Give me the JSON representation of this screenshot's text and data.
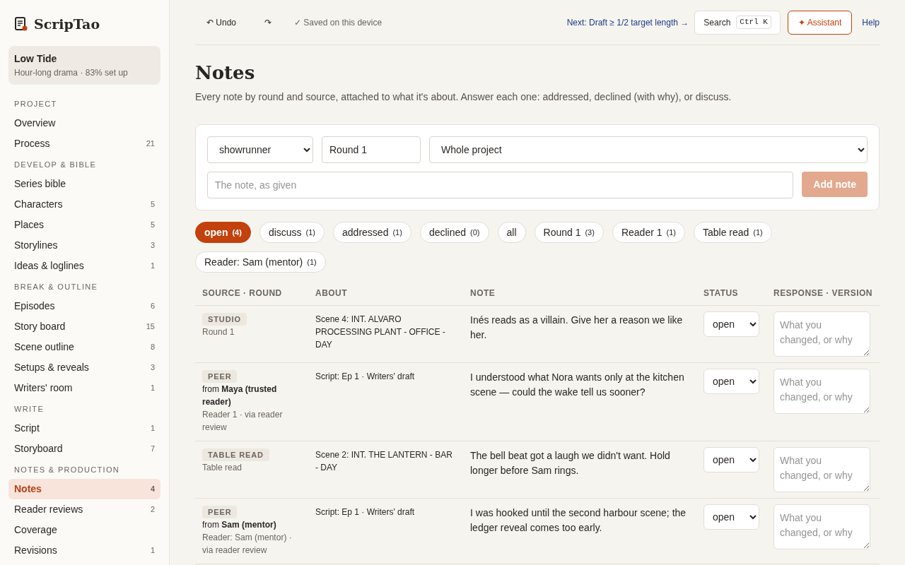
{
  "app": {
    "name": "ScripTao"
  },
  "project": {
    "title": "Low Tide",
    "subtitle": "Hour-long drama · 83% set up"
  },
  "nav": [
    {
      "heading": "PROJECT",
      "items": [
        {
          "label": "Overview",
          "selected": false
        },
        {
          "label": "Process",
          "count": "21",
          "selected": false
        }
      ]
    },
    {
      "heading": "DEVELOP & BIBLE",
      "items": [
        {
          "label": "Series bible",
          "selected": false
        },
        {
          "label": "Characters",
          "count": "5",
          "selected": false
        },
        {
          "label": "Places",
          "count": "5",
          "selected": false
        },
        {
          "label": "Storylines",
          "count": "3",
          "selected": false
        },
        {
          "label": "Ideas & loglines",
          "count": "1",
          "selected": false
        }
      ]
    },
    {
      "heading": "BREAK & OUTLINE",
      "items": [
        {
          "label": "Episodes",
          "count": "6",
          "selected": false
        },
        {
          "label": "Story board",
          "count": "15",
          "selected": false
        },
        {
          "label": "Scene outline",
          "count": "8",
          "selected": false
        },
        {
          "label": "Setups & reveals",
          "count": "3",
          "selected": false
        },
        {
          "label": "Writers' room",
          "count": "1",
          "selected": false
        }
      ]
    },
    {
      "heading": "WRITE",
      "items": [
        {
          "label": "Script",
          "count": "1",
          "selected": false
        },
        {
          "label": "Storyboard",
          "count": "7",
          "selected": false
        }
      ]
    },
    {
      "heading": "NOTES & PRODUCTION",
      "items": [
        {
          "label": "Notes",
          "count": "4",
          "selected": true
        },
        {
          "label": "Reader reviews",
          "count": "2",
          "selected": false
        },
        {
          "label": "Coverage",
          "selected": false
        },
        {
          "label": "Revisions",
          "count": "1",
          "selected": false
        }
      ]
    }
  ],
  "toolbar": {
    "undo": "↶ Undo",
    "redo": "↷",
    "saved": "✓ Saved on this device",
    "next": "Next: Draft ≥ 1/2 target length →",
    "search": {
      "label": "Search",
      "shortcut": "Ctrl K"
    },
    "assistant": "✦ Assistant",
    "help": "Help"
  },
  "page": {
    "title": "Notes",
    "description": "Every note by round and source, attached to what it's about. Answer each one: addressed, declined (with why), or discuss."
  },
  "form": {
    "source": "showrunner",
    "round": "Round 1",
    "scope": "Whole project",
    "note_placeholder": "The note, as given",
    "add_button": {
      "label": "Add note",
      "disabled": true
    }
  },
  "filters": [
    {
      "label": "open",
      "count": "(4)",
      "selected": true
    },
    {
      "label": "discuss",
      "count": "(1)",
      "selected": false
    },
    {
      "label": "addressed",
      "count": "(1)",
      "selected": false
    },
    {
      "label": "declined",
      "count": "(0)",
      "selected": false
    },
    {
      "label": "all",
      "selected": false
    },
    {
      "label": "Round 1",
      "count": "(3)",
      "selected": false
    },
    {
      "label": "Reader 1",
      "count": "(1)",
      "selected": false
    },
    {
      "label": "Table read",
      "count": "(1)",
      "selected": false
    },
    {
      "label": "Reader: Sam (mentor)",
      "count": "(1)",
      "selected": false
    }
  ],
  "table": {
    "columns": [
      "SOURCE · ROUND",
      "ABOUT",
      "NOTE",
      "STATUS",
      "RESPONSE · VERSION"
    ],
    "rows": [
      {
        "tag": "STUDIO",
        "round": "Round 1",
        "about": "Scene 4: INT. ALVARO PROCESSING PLANT - OFFICE - DAY",
        "note": "Inés reads as a villain. Give her a reason we like her.",
        "status": "open",
        "response_placeholder": "What you changed, or why"
      },
      {
        "tag": "PEER",
        "from": "from **Maya (trusted reader)**",
        "round": "Reader 1 · via reader review",
        "about": "Script: Ep 1 · Writers' draft",
        "note": "I understood what Nora wants only at the kitchen scene — could the wake tell us sooner?",
        "status": "open",
        "response_placeholder": "What you changed, or why"
      },
      {
        "tag": "TABLE READ",
        "round": "Table read",
        "about": "Scene 2: INT. THE LANTERN - BAR - DAY",
        "note": "The bell beat got a laugh we didn't want. Hold longer before Sam rings.",
        "status": "open",
        "response_placeholder": "What you changed, or why"
      },
      {
        "tag": "PEER",
        "from": "from **Sam (mentor)**",
        "round": "Reader: Sam (mentor) · via reader review",
        "about": "Script: Ep 1 · Writers' draft",
        "note": "I was hooked until the second harbour scene; the ledger reveal comes too early.",
        "status": "open",
        "response_placeholder": "What you changed, or why"
      }
    ]
  }
}
